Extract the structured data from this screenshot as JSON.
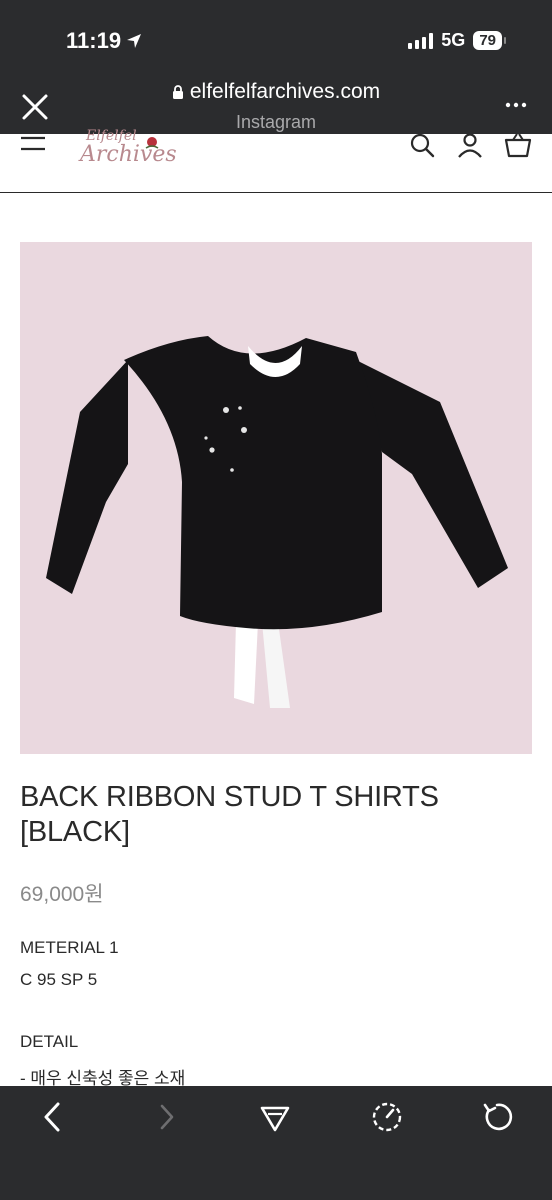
{
  "status_bar": {
    "time": "11:19",
    "network": "5G",
    "battery": "79"
  },
  "browser": {
    "url": "elfelfelfarchives.com",
    "source": "Instagram"
  },
  "site": {
    "logo_line1": "Elfelfel",
    "logo_line2": "Archives"
  },
  "product": {
    "title_line1": "BACK RIBBON STUD T SHIRTS",
    "title_line2": "[BLACK]",
    "price": "69,000원",
    "material_label": "METERIAL 1",
    "material_value": "C 95 SP 5",
    "detail_label": "DETAIL",
    "detail_line1": "- 매우 신축성 좋은 소재"
  },
  "colors": {
    "browser_chrome": "#2b2c2e",
    "image_background": "#ead8df",
    "shirt": "#151416",
    "ribbon": "#ffffff",
    "logo": "#b8898e"
  },
  "icons": {
    "close": "close-icon",
    "more": "more-icon",
    "menu": "hamburger-icon",
    "search": "search-icon",
    "account": "user-icon",
    "cart": "basket-icon",
    "back": "chevron-left-icon",
    "forward": "chevron-right-icon",
    "share": "send-icon",
    "speed": "gauge-icon",
    "reload": "reload-icon"
  }
}
